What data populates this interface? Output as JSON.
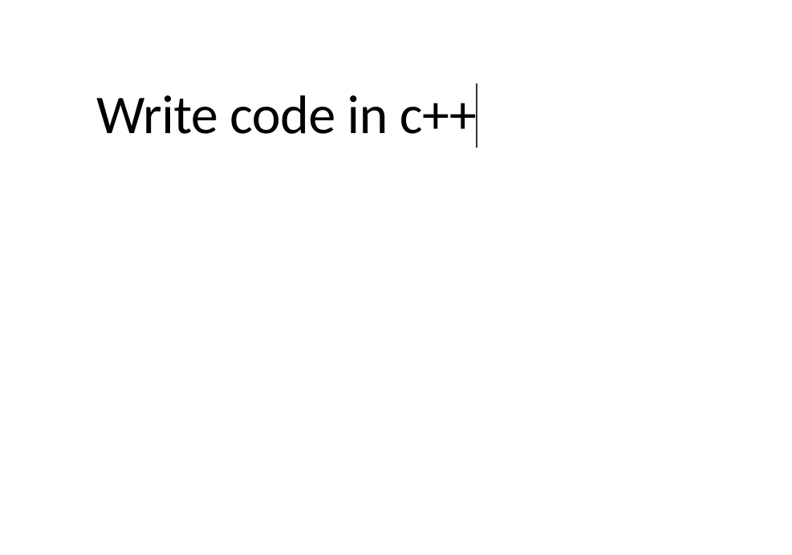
{
  "document": {
    "text": "Write code in c++"
  }
}
